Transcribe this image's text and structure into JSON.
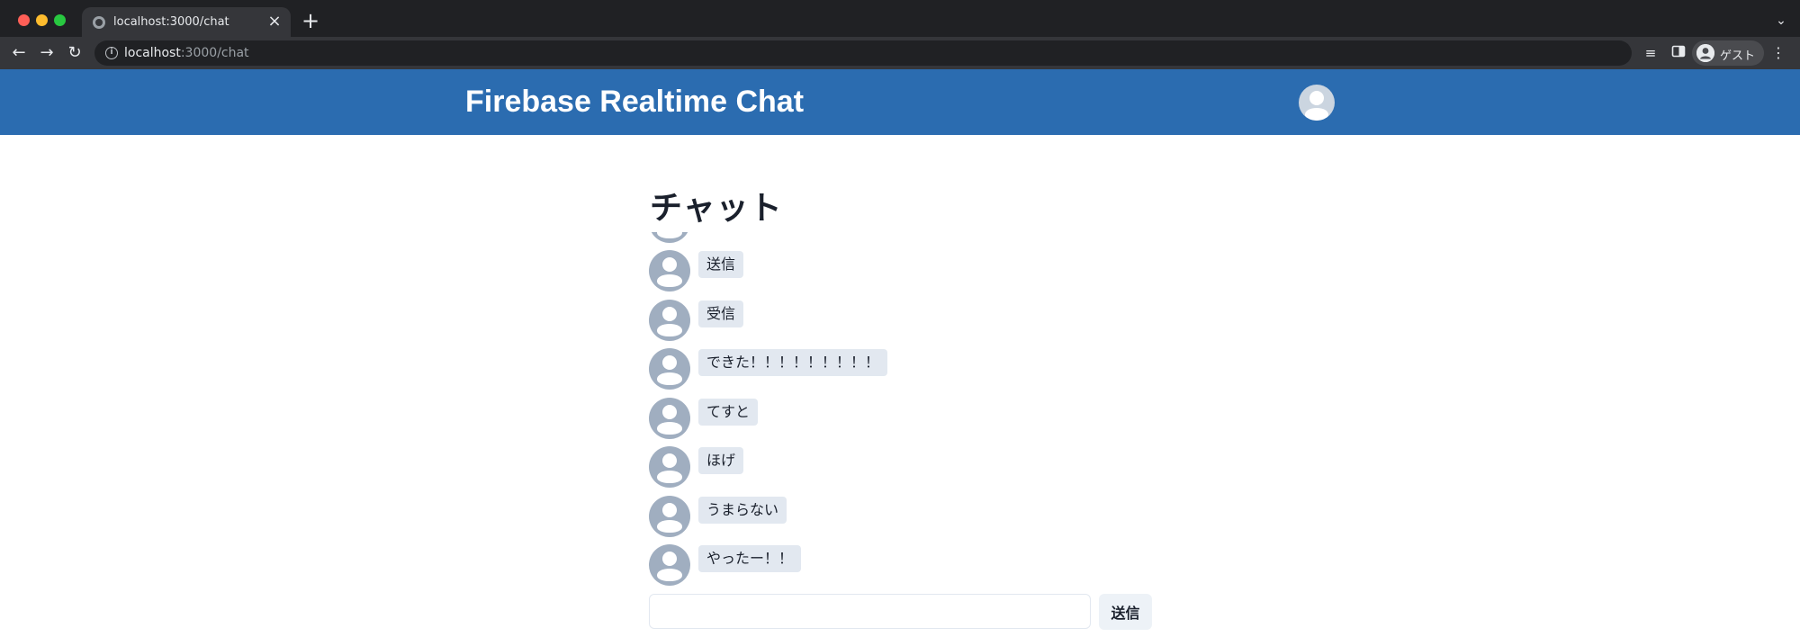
{
  "browser": {
    "tab_title": "localhost:3000/chat",
    "tab_close": "×",
    "new_tab": "+",
    "url_host": "localhost",
    "url_path": ":3000/chat",
    "profile_name": "ゲスト",
    "icons": {
      "back": "back-arrow-icon",
      "forward": "forward-arrow-icon",
      "reload": "reload-icon",
      "info": "info-icon",
      "media": "media-control-icon",
      "side_panel": "side-panel-icon",
      "menu": "more-vert-icon",
      "tab_search": "chevron-down-icon"
    }
  },
  "header": {
    "title": "Firebase Realtime Chat",
    "background": "#2b6cb0"
  },
  "main": {
    "heading": "チャット",
    "messages": [
      {
        "text": "送信"
      },
      {
        "text": "受信"
      },
      {
        "text": "できた！！！！！！！！！"
      },
      {
        "text": "てすと"
      },
      {
        "text": "ほげ"
      },
      {
        "text": "うまらない"
      },
      {
        "text": "やったー！！"
      }
    ],
    "composer": {
      "input_value": "",
      "send_label": "送信"
    }
  }
}
